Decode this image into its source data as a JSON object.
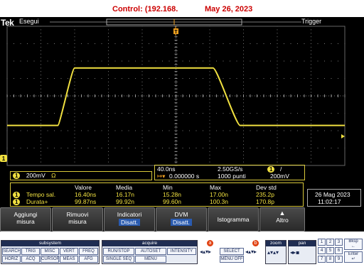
{
  "header": {
    "control": "Control: (192.168.",
    "date": "May 26, 2023"
  },
  "scope": {
    "brand": "Tek",
    "run_state": "Esegui",
    "trigger_label": "Trigger",
    "trigger_marker": "T",
    "channel_number": "1",
    "waveform": {
      "baseline_div": -1.7,
      "top_div": 1.6,
      "rise_start_div": 1.5,
      "rise_end_div": 2.0,
      "fall_start_div": 6.1,
      "fall_end_div": 6.9
    }
  },
  "ch1": {
    "scale": "200mV",
    "coupling_symbol": "Ω"
  },
  "timebase": {
    "scale": "40.0ns",
    "position": "0.000000 s",
    "sample_rate": "2.50GS/s",
    "record_length": "1000 punti",
    "trigger_slope": "/",
    "trigger_level": "200mV"
  },
  "measurements": {
    "columns": [
      "Valore",
      "Media",
      "Min",
      "Max",
      "Dev std"
    ],
    "rows": [
      {
        "label": "Tempo sal.",
        "values": [
          "16.40ns",
          "16.17n",
          "15.28n",
          "17.00n",
          "235.2p"
        ]
      },
      {
        "label": "Durata+",
        "values": [
          "99.87ns",
          "99.92n",
          "99.60n",
          "100.3n",
          "170.8p"
        ]
      }
    ]
  },
  "datetime": {
    "date": "26 Mag 2023",
    "time": "11:02:17"
  },
  "softkeys": [
    {
      "line1": "Aggiungi",
      "line2": "misura",
      "sub": ""
    },
    {
      "line1": "Rimuovi",
      "line2": "misura",
      "sub": ""
    },
    {
      "line1": "Indicatori",
      "line2": "",
      "sub": "Disatt."
    },
    {
      "line1": "DVM",
      "line2": "",
      "sub": "Disatt."
    },
    {
      "line1": "Istogramma",
      "line2": "",
      "sub": ""
    },
    {
      "line1": "Altro",
      "line2": "",
      "sub": ""
    }
  ],
  "panel": {
    "subsystem": {
      "title": "subsystem",
      "keys": [
        "SEARCH",
        "TRIG",
        "MISC",
        "VERT",
        "FREQ",
        "HORIZ",
        "ACQ",
        "CURSOR",
        "MEAS",
        "AFG"
      ]
    },
    "acquire": {
      "title": "acquire",
      "keys": [
        "RUN/STOP",
        "AUTOSET",
        "INTENSITY",
        "SINGLE SEQ",
        "MENU"
      ]
    },
    "ab": {
      "a": "a",
      "b": "b",
      "select": "SELECT",
      "menu_off": "MENU OFF"
    },
    "zoom": {
      "title": "zoom"
    },
    "pan": {
      "title": "pan"
    },
    "keypad": {
      "keys": [
        "1",
        "2",
        "3",
        "4",
        "5",
        "6",
        "7",
        "8",
        "9"
      ],
      "bksp": "Bksp",
      "enter": "Enter"
    }
  }
}
